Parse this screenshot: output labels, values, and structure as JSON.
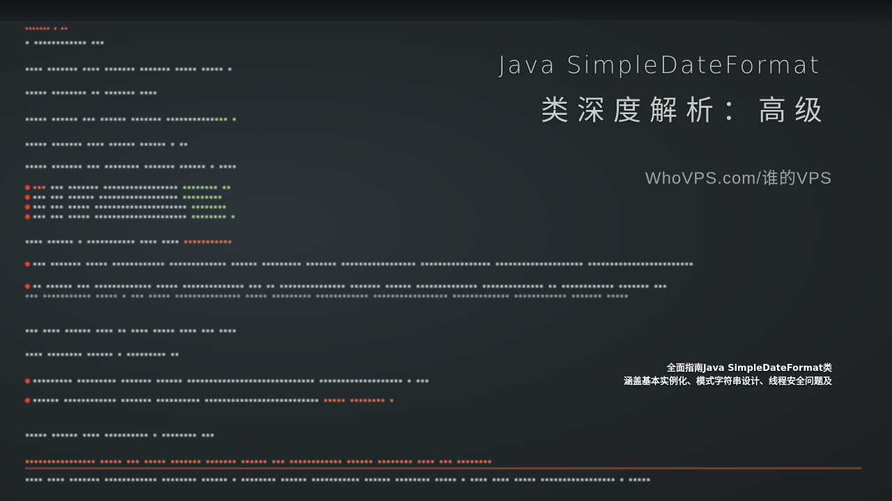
{
  "title": {
    "line1": "Java SimpleDateFormat",
    "line2": "类深度解析：高级"
  },
  "site_label": "WhoVPS.com/谁的VPS",
  "description": {
    "line1": "全面指南Java SimpleDateFormat类",
    "line2": "涵盖基本实例化、模式字符串设计、线程安全问题及"
  },
  "colors": {
    "background": "#232a2e",
    "title_text": "#c7ccc9",
    "site_text": "#9ba2a1",
    "description_text": "#ffffff"
  }
}
